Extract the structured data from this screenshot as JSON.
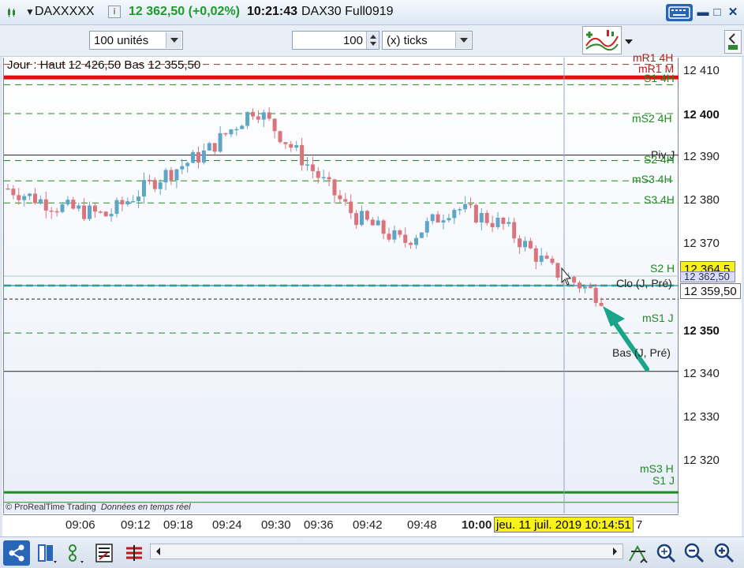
{
  "titlebar": {
    "ticker": "DAXXXXX",
    "info": "i",
    "price": "12 362,50 (+0,02%)",
    "time": "10:21:43",
    "contract": "DAX30 Full0919"
  },
  "toolbar": {
    "units": "100 unités",
    "ticks_value": "100",
    "ticks_unit": "(x) ticks"
  },
  "chart": {
    "header": "Jour : Haut 12 426,50 Bas 12 355,50",
    "copyright": "© ProRealTime Trading",
    "realtime": "Données en temps réel",
    "last_price": "12 364,5",
    "close_price_box": "12 362,50",
    "cursor_price": "12 359,50",
    "cursor_time": "jeu. 11 juil. 2019 10:14:51",
    "x_suffix": "7",
    "y_ticks": [
      "12 410",
      "12 400",
      "12 390",
      "12 380",
      "12 370",
      "12 350",
      "12 340",
      "12 330",
      "12 320"
    ],
    "x_ticks": [
      "09:06",
      "09:12",
      "09:18",
      "09:24",
      "09:30",
      "09:36",
      "09:42",
      "09:48",
      "10:00"
    ],
    "levels": {
      "mr1_4h": "mR1 4H",
      "mr1_m": "mR1 M",
      "s1_4h": "S1 4H",
      "ms2_4h": "mS2 4H",
      "piv_j": "Piv J",
      "s2_4h": "S2 4H",
      "ms3_4h": "mS3 4H",
      "s3_4h": "S3 4H",
      "s2_h": "S2 H",
      "clo": "Clo (J, Pré)",
      "ms1_j": "mS1 J",
      "bas": "Bas (J, Pré)",
      "ms3_h": "mS3 H",
      "s1_j": "S1 J"
    },
    "colors": {
      "up": "#5ea5c8",
      "down": "#d9737c",
      "resistance": "#e01010",
      "support": "#1f8a1f",
      "pivot": "#222222",
      "arrow": "#1aa58a",
      "highlight": "#f8f21a"
    }
  },
  "chart_data": {
    "type": "candlestick",
    "xlabel": "",
    "ylabel": "",
    "ylim": [
      12312,
      12413
    ],
    "x": [
      "09:06",
      "09:12",
      "09:18",
      "09:24",
      "09:30",
      "09:36",
      "09:42",
      "09:48",
      "10:00"
    ],
    "series": [
      {
        "values": [
          12384,
          12380,
          12378,
          12386,
          12392,
          12402,
          12390,
          12378,
          12372,
          12380,
          12376,
          12366,
          12360
        ]
      }
    ]
  }
}
